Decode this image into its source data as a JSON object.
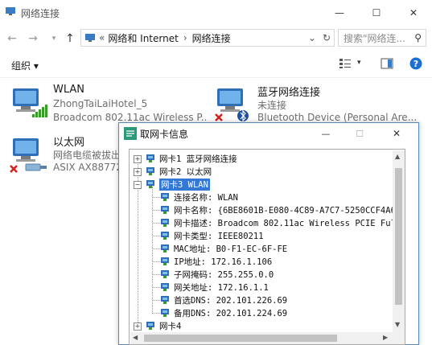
{
  "window": {
    "title": "网络连接",
    "minimize_glyph": "—",
    "maximize_glyph": "☐",
    "close_glyph": "✕"
  },
  "address": {
    "prefix_glyph": "«",
    "crumb1": "网络和 Internet",
    "crumb2": "网络连接",
    "search_placeholder": "搜索\"网络连..."
  },
  "toolbar": {
    "organize_label": "组织 ▾"
  },
  "adapters": [
    {
      "name": "WLAN",
      "line1": "ZhongTaiLaiHotel_5",
      "line2": "Broadcom 802.11ac Wireless P..."
    },
    {
      "name": "蓝牙网络连接",
      "line1": "未连接",
      "line2": "Bluetooth Device (Personal Are..."
    },
    {
      "name": "以太网",
      "line1": "网络电缆被拔出",
      "line2": "ASIX AX88772..."
    }
  ],
  "dialog": {
    "title": "取网卡信息",
    "minimize_glyph": "—",
    "maximize_glyph": "☐",
    "close_glyph": "✕",
    "tree": {
      "card1": "网卡1 蓝牙网络连接",
      "card2": "网卡2 以太网",
      "card3": "网卡3 WLAN",
      "details": [
        "连接名称: WLAN",
        "网卡名称: {6BE8601B-E080-4C89-A7C7-5250CCF4A6",
        "网卡描述: Broadcom 802.11ac Wireless PCIE Ful",
        "网卡类型: IEEE80211",
        "MAC地址: B0-F1-EC-6F-FE",
        "IP地址: 172.16.1.106",
        "子网掩码: 255.255.0.0",
        "网关地址: 172.16.1.1",
        "首选DNS: 202.101.226.69",
        "备用DNS: 202.101.224.69"
      ],
      "card4": "网卡4"
    }
  },
  "colors": {
    "accent": "#3478d6",
    "help_blue": "#1a6fd1"
  }
}
